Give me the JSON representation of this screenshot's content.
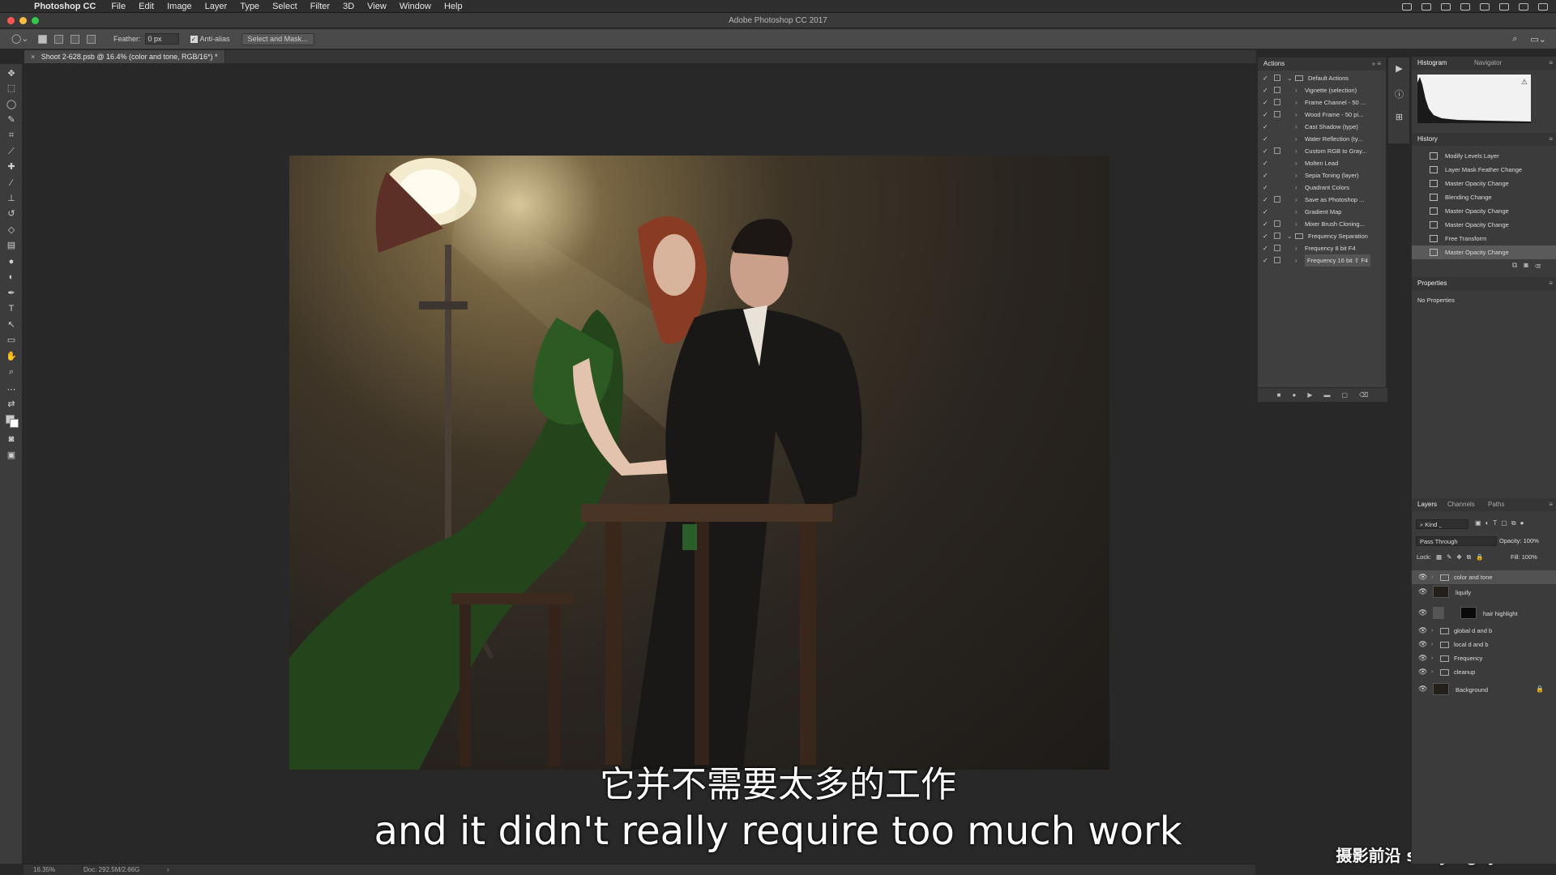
{
  "menubar": {
    "app_name": "Photoshop CC",
    "items": [
      "File",
      "Edit",
      "Image",
      "Layer",
      "Type",
      "Select",
      "Filter",
      "3D",
      "View",
      "Window",
      "Help"
    ]
  },
  "window": {
    "title": "Adobe Photoshop CC 2017"
  },
  "options_bar": {
    "feather_label": "Feather:",
    "feather_value": "0 px",
    "anti_alias_label": "Anti-alias",
    "select_mask_label": "Select and Mask..."
  },
  "document_tab": {
    "title": "Shoot 2-628.psb @ 16.4% (color and tone, RGB/16*) *"
  },
  "status_bar": {
    "zoom": "16.35%",
    "doc_size": "Doc: 292.5M/2.66G"
  },
  "actions_panel": {
    "title": "Actions",
    "items": [
      {
        "label": "Default Actions",
        "type": "set",
        "checked": true,
        "dialog": true
      },
      {
        "label": "Vignette (selection)",
        "type": "action",
        "checked": true,
        "dialog": true
      },
      {
        "label": "Frame Channel - 50 ...",
        "type": "action",
        "checked": true,
        "dialog": true
      },
      {
        "label": "Wood Frame - 50 pi...",
        "type": "action",
        "checked": true,
        "dialog": true
      },
      {
        "label": "Cast Shadow (type)",
        "type": "action",
        "checked": true,
        "dialog": false
      },
      {
        "label": "Water Reflection (ty...",
        "type": "action",
        "checked": true,
        "dialog": false
      },
      {
        "label": "Custom RGB to Gray...",
        "type": "action",
        "checked": true,
        "dialog": true
      },
      {
        "label": "Molten Lead",
        "type": "action",
        "checked": true,
        "dialog": false
      },
      {
        "label": "Sepia Toning (layer)",
        "type": "action",
        "checked": true,
        "dialog": false
      },
      {
        "label": "Quadrant Colors",
        "type": "action",
        "checked": true,
        "dialog": false
      },
      {
        "label": "Save as Photoshop ...",
        "type": "action",
        "checked": true,
        "dialog": true
      },
      {
        "label": "Gradient Map",
        "type": "action",
        "checked": true,
        "dialog": false
      },
      {
        "label": "Mixer Brush Cloning...",
        "type": "action",
        "checked": true,
        "dialog": true
      },
      {
        "label": "Frequency Separation",
        "type": "set",
        "checked": true,
        "dialog": true
      },
      {
        "label": "Frequency 8 bit      F4",
        "type": "action",
        "checked": true,
        "dialog": true
      },
      {
        "label": "Frequency 16 bit ⇧ F4",
        "type": "action",
        "checked": true,
        "dialog": true,
        "selected": true
      }
    ]
  },
  "histogram_panel": {
    "tabs": [
      "Histogram",
      "Navigator"
    ]
  },
  "history_panel": {
    "title": "History",
    "items": [
      {
        "label": "Modify Levels Layer"
      },
      {
        "label": "Layer Mask Feather Change"
      },
      {
        "label": "Master Opacity Change"
      },
      {
        "label": "Blending Change"
      },
      {
        "label": "Master Opacity Change"
      },
      {
        "label": "Master Opacity Change"
      },
      {
        "label": "Free Transform"
      },
      {
        "label": "Master Opacity Change",
        "selected": true
      }
    ]
  },
  "properties_panel": {
    "title": "Properties",
    "empty_text": "No Properties"
  },
  "layers_panel": {
    "tabs": [
      "Layers",
      "Channels",
      "Paths"
    ],
    "kind_label": "Kind",
    "blend_mode": "Pass Through",
    "opacity_label": "Opacity:",
    "opacity_value": "100%",
    "lock_label": "Lock:",
    "fill_label": "Fill:",
    "fill_value": "100%",
    "layers": [
      {
        "name": "color and tone",
        "type": "group",
        "selected": true
      },
      {
        "name": "liquify",
        "type": "pixel"
      },
      {
        "name": "hair highlight",
        "type": "adjustment"
      },
      {
        "name": "global d and b",
        "type": "group"
      },
      {
        "name": "local d and b",
        "type": "group"
      },
      {
        "name": "Frequency",
        "type": "group"
      },
      {
        "name": "cleanup",
        "type": "group"
      },
      {
        "name": "Background",
        "type": "pixel",
        "locked": true
      }
    ]
  },
  "subtitles": {
    "chinese": "它并不需要太多的工作",
    "english": "and it didn't really require too much work"
  },
  "watermark": "摄影前沿 sheyingzyz.com",
  "colors": {
    "menubar_bg": "#2e2e2e",
    "panel_bg": "#3b3b3b",
    "canvas_bg": "#282828",
    "selected_row": "#525252",
    "dress_green": "#2d5a22"
  }
}
